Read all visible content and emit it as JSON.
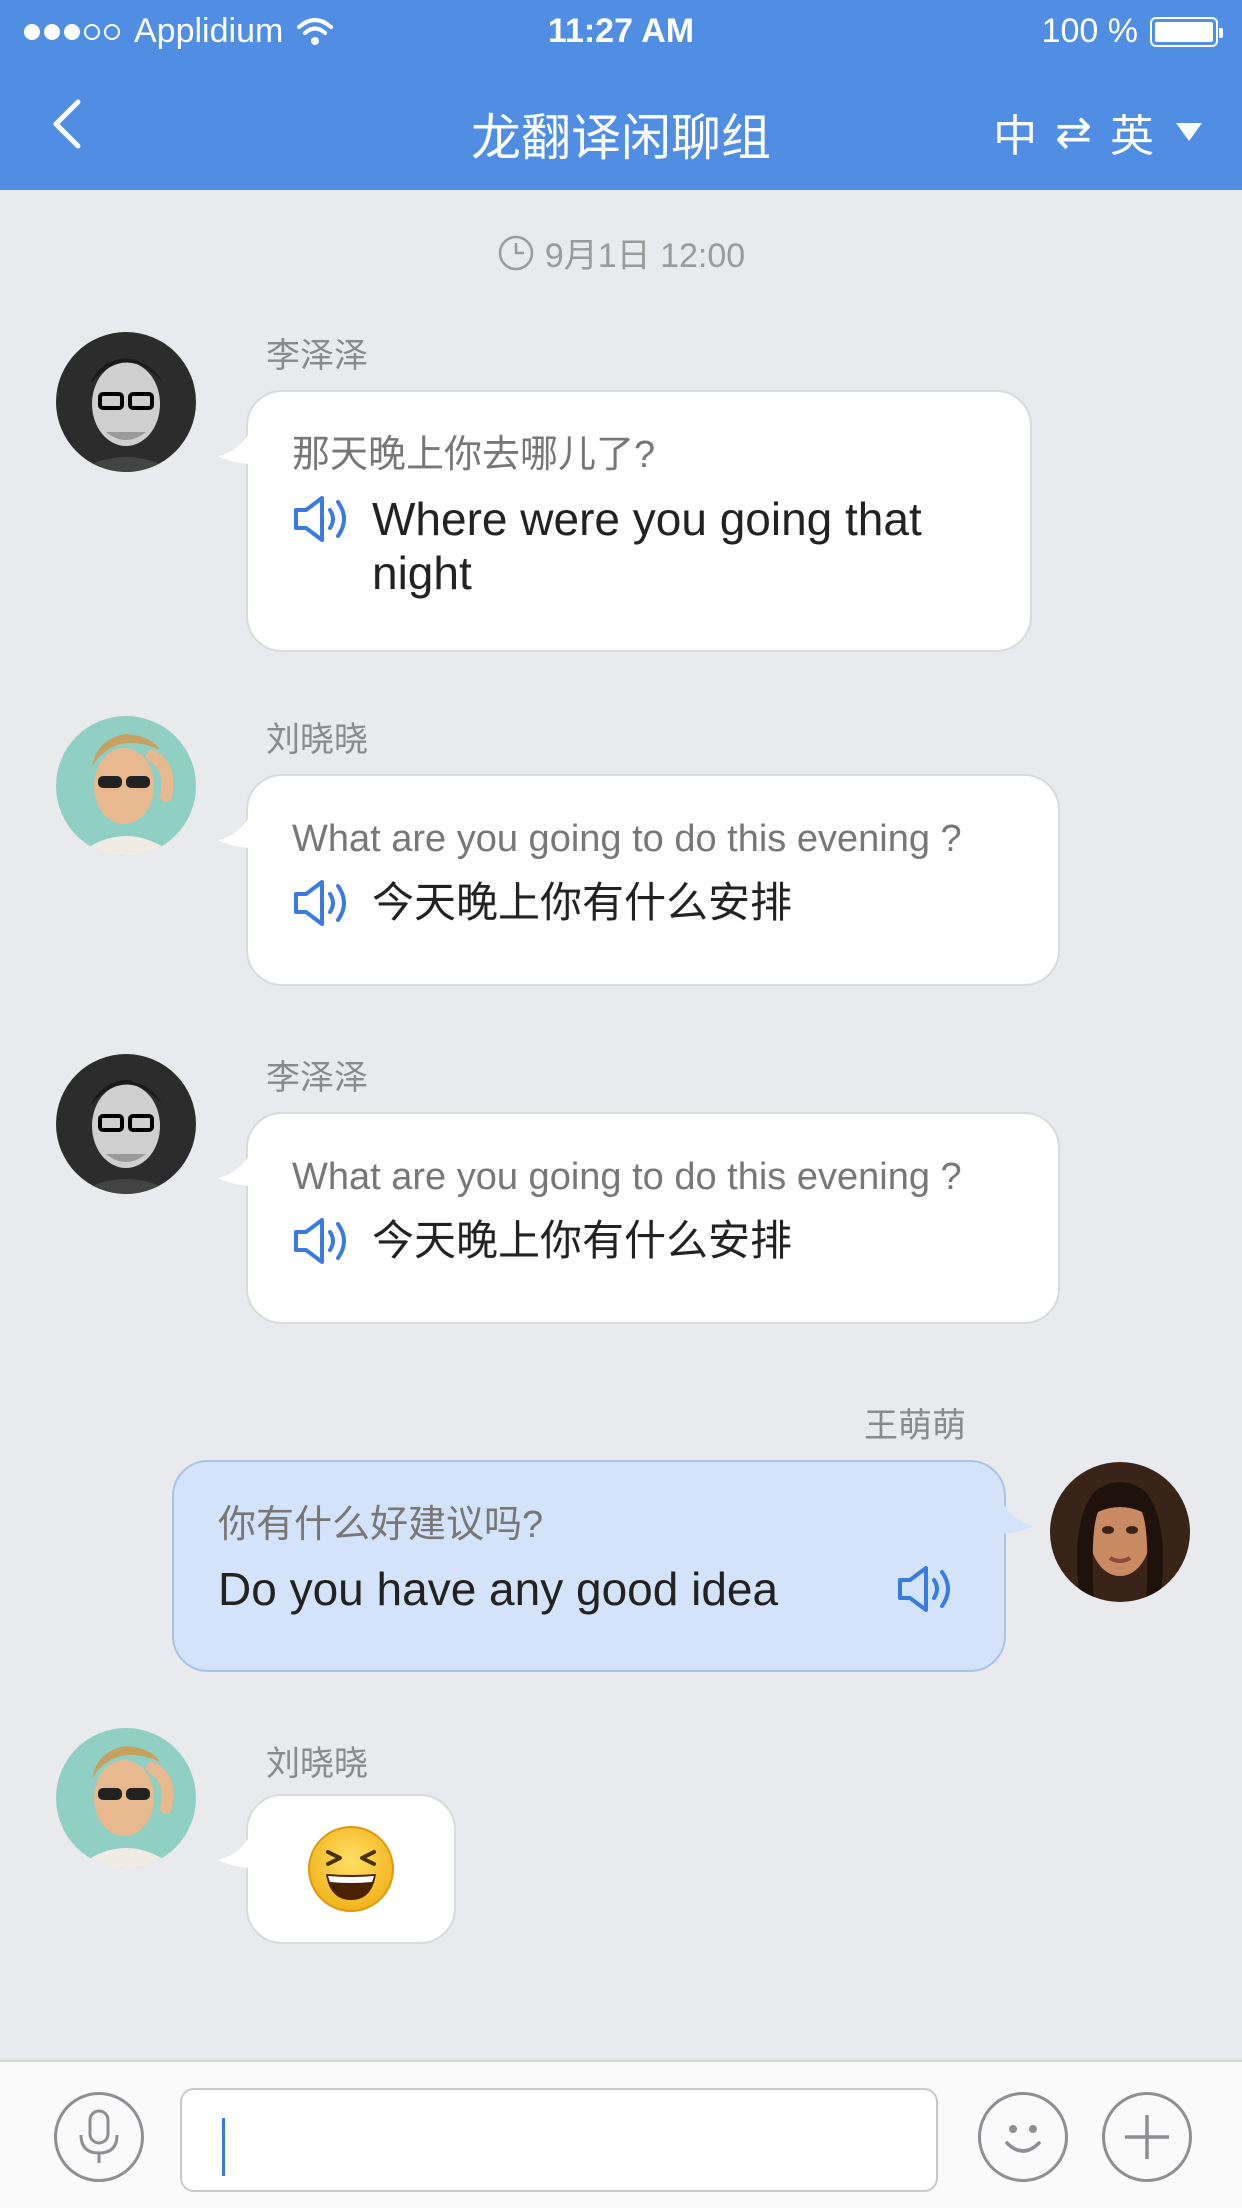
{
  "status_bar": {
    "carrier": "Applidium",
    "time": "11:27 AM",
    "battery_percent": "100 %"
  },
  "nav": {
    "title": "龙翻译闲聊组",
    "lang_from": "中",
    "lang_swap": "⇄",
    "lang_to": "英"
  },
  "timestamp": "9月1日 12:00",
  "messages": [
    {
      "sender": "李泽泽",
      "original": "那天晚上你去哪儿了?",
      "translation": "Where were you going that night",
      "avatar": "man-glasses-bw"
    },
    {
      "sender": "刘晓晓",
      "original": "What are you going to do this evening ?",
      "translation": "今天晚上你有什么安排",
      "avatar": "man-sunglasses"
    },
    {
      "sender": "李泽泽",
      "original": "What are you going to do this evening ?",
      "translation": "今天晚上你有什么安排",
      "avatar": "man-glasses-bw"
    },
    {
      "sender": "王萌萌",
      "original": "你有什么好建议吗?",
      "translation": "Do you have any good idea",
      "avatar": "woman"
    },
    {
      "sender": "刘晓晓",
      "emoji": "laughing-face",
      "avatar": "man-sunglasses"
    }
  ],
  "input": {
    "value": "",
    "placeholder": ""
  },
  "colors": {
    "header": "#4f8ee3",
    "background": "#e9eaee",
    "my_bubble": "#d3e4fa",
    "accent": "#3a7be0"
  }
}
